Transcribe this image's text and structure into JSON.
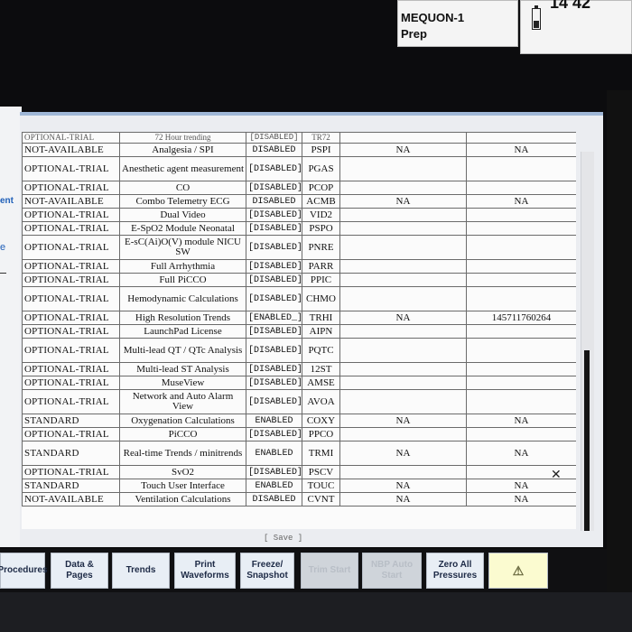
{
  "status": {
    "location": "MEQUON-1",
    "mode": "Prep",
    "clock": "14 42"
  },
  "side": {
    "text": "ent",
    "glyph": "e"
  },
  "table": {
    "top_row": [
      "OPTIONAL-TRIAL",
      "72 Hour trending",
      "[DISABLED]",
      "TR72",
      "",
      ""
    ],
    "rows": [
      [
        "NOT-AVAILABLE",
        "Analgesia / SPI",
        "DISABLED",
        "PSPI",
        "NA",
        "NA"
      ],
      [
        "OPTIONAL-TRIAL",
        "Anesthetic agent measurement",
        "[DISABLED]",
        "PGAS",
        "",
        ""
      ],
      [
        "OPTIONAL-TRIAL",
        "CO",
        "[DISABLED]",
        "PCOP",
        "",
        ""
      ],
      [
        "NOT-AVAILABLE",
        "Combo Telemetry ECG",
        "DISABLED",
        "ACMB",
        "NA",
        "NA"
      ],
      [
        "OPTIONAL-TRIAL",
        "Dual Video",
        "[DISABLED]",
        "VID2",
        "",
        ""
      ],
      [
        "OPTIONAL-TRIAL",
        "E-SpO2 Module Neonatal",
        "[DISABLED]",
        "PSPO",
        "",
        ""
      ],
      [
        "OPTIONAL-TRIAL",
        "E-sC(Ai)O(V) module NICU SW",
        "[DISABLED]",
        "PNRE",
        "",
        ""
      ],
      [
        "OPTIONAL-TRIAL",
        "Full Arrhythmia",
        "[DISABLED]",
        "PARR",
        "",
        ""
      ],
      [
        "OPTIONAL-TRIAL",
        "Full PiCCO",
        "[DISABLED]",
        "PPIC",
        "",
        ""
      ],
      [
        "OPTIONAL-TRIAL",
        "Hemodynamic Calculations",
        "[DISABLED]",
        "CHMO",
        "",
        ""
      ],
      [
        "OPTIONAL-TRIAL",
        "High Resolution Trends",
        "[ENABLED_]",
        "TRHI",
        "NA",
        "14571176026​4"
      ],
      [
        "OPTIONAL-TRIAL",
        "LaunchPad License",
        "[DISABLED]",
        "AIPN",
        "",
        ""
      ],
      [
        "OPTIONAL-TRIAL",
        "Multi-lead QT / QTc Analysis",
        "[DISABLED]",
        "PQTC",
        "",
        ""
      ],
      [
        "OPTIONAL-TRIAL",
        "Multi-lead ST Analysis",
        "[DISABLED]",
        "12ST",
        "",
        ""
      ],
      [
        "OPTIONAL-TRIAL",
        "MuseView",
        "[DISABLED]",
        "AMSE",
        "",
        ""
      ],
      [
        "OPTIONAL-TRIAL",
        "Network and Auto Alarm View",
        "[DISABLED]",
        "AVOA",
        "",
        ""
      ],
      [
        "STANDARD",
        "Oxygenation Calculations",
        "ENABLED",
        "COXY",
        "NA",
        "NA"
      ],
      [
        "OPTIONAL-TRIAL",
        "PiCCO",
        "[DISABLED]",
        "PPCO",
        "",
        ""
      ],
      [
        "STANDARD",
        "Real-time Trends / minitrends",
        "ENABLED",
        "TRMI",
        "NA",
        "NA"
      ],
      [
        "OPTIONAL-TRIAL",
        "SvO2",
        "[DISABLED]",
        "PSCV",
        "",
        ""
      ],
      [
        "STANDARD",
        "Touch User Interface",
        "ENABLED",
        "TOUC",
        "NA",
        "NA"
      ],
      [
        "NOT-AVAILABLE",
        "Ventilation Calculations",
        "DISABLED",
        "CVNT",
        "NA",
        "NA"
      ]
    ],
    "save_label": "[ Save ]"
  },
  "buttons": [
    {
      "label": "Procedures"
    },
    {
      "label": "Data & Pages"
    },
    {
      "label": "Trends"
    },
    {
      "label": "Print Waveforms"
    },
    {
      "label": "Freeze/ Snapshot"
    },
    {
      "label": "Trim Start"
    },
    {
      "label": "NBP Auto Start"
    },
    {
      "label": "Zero All Pressures"
    },
    {
      "label": "",
      "icon": "alarm-silence-icon"
    }
  ],
  "colors": {
    "header_accent": "#9fb7d6",
    "side_text": "#1f5fb8",
    "button_bg": "#e8eef5"
  }
}
